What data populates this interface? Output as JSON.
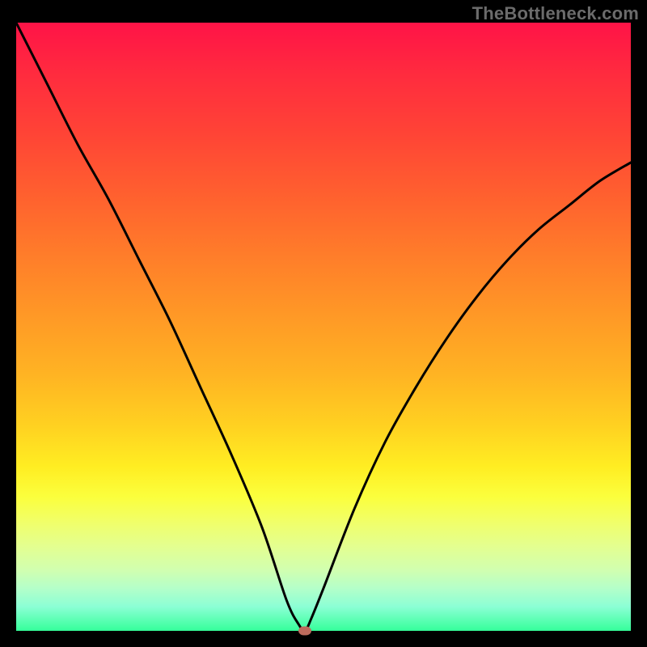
{
  "attribution": "TheBottleneck.com",
  "chart_data": {
    "type": "line",
    "title": "",
    "xlabel": "",
    "ylabel": "",
    "xlim": [
      0,
      100
    ],
    "ylim": [
      0,
      100
    ],
    "x": [
      0,
      5,
      10,
      15,
      20,
      25,
      30,
      35,
      40,
      44,
      46,
      47,
      48,
      50,
      55,
      60,
      65,
      70,
      75,
      80,
      85,
      90,
      95,
      100
    ],
    "values": [
      100,
      90,
      80,
      71,
      61,
      51,
      40,
      29,
      17,
      5,
      1,
      0,
      2,
      7,
      20,
      31,
      40,
      48,
      55,
      61,
      66,
      70,
      74,
      77
    ],
    "minimum": {
      "x": 47,
      "y": 0
    },
    "gradient_stops": [
      {
        "pos": 0,
        "color": "#ff1347"
      },
      {
        "pos": 50,
        "color": "#ffb423"
      },
      {
        "pos": 78,
        "color": "#fbff3d"
      },
      {
        "pos": 100,
        "color": "#35ff9a"
      }
    ]
  }
}
